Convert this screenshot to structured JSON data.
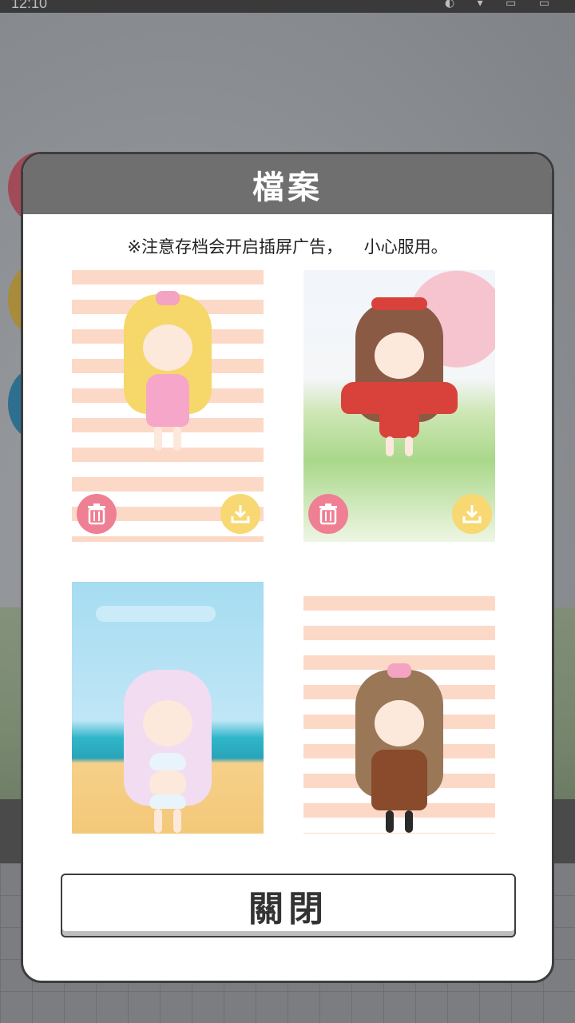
{
  "status_bar": {
    "time": "12:10"
  },
  "dialog": {
    "title": "檔案",
    "notice": "※注意存档会开启插屏广告，    小心服用。",
    "close_label": "關閉",
    "saves": [
      {
        "background": "stripes",
        "hair_color": "#f5d76a",
        "outfit_color": "#f6a6c9",
        "has_actions": true
      },
      {
        "background": "park",
        "hair_color": "#8a5a45",
        "outfit_color": "#d9423b",
        "has_actions": true
      },
      {
        "background": "beach",
        "hair_color": "#f1dcf2",
        "outfit_color": "#e9f3fb",
        "has_actions": false
      },
      {
        "background": "stripes",
        "hair_color": "#9a7757",
        "outfit_color": "#8a4a2c",
        "has_actions": false
      }
    ],
    "icons": {
      "delete": "trash-icon",
      "load": "download-icon"
    },
    "colors": {
      "delete_button": "#ef7f93",
      "load_button": "#f7d873",
      "header": "#6f6f6f"
    }
  }
}
